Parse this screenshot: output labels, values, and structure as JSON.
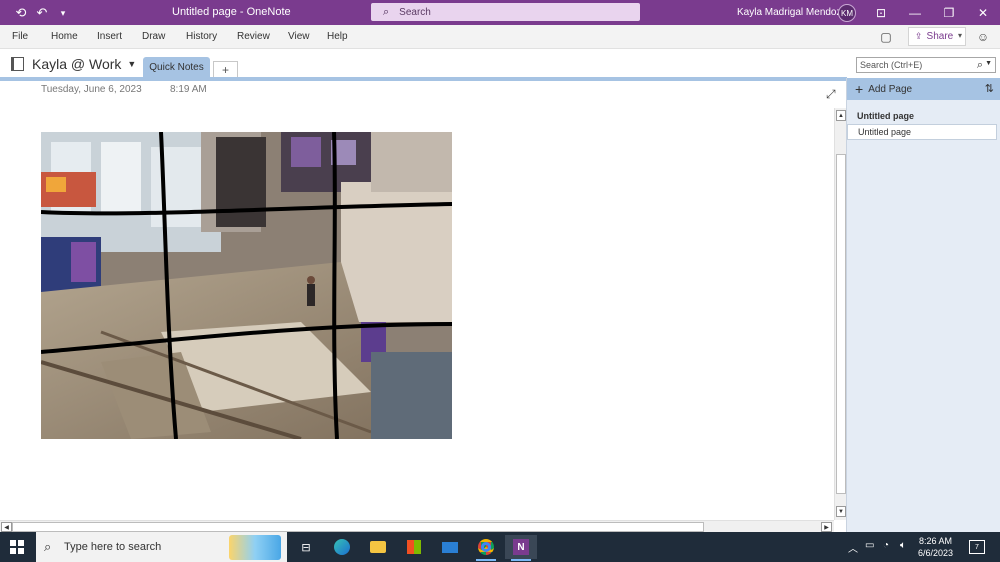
{
  "window": {
    "title": "Untitled page  -  OneNote",
    "search_placeholder": "Search",
    "user_name": "Kayla Madrigal Mendoza",
    "user_initials": "KM"
  },
  "ribbon": {
    "tabs": [
      "File",
      "Home",
      "Insert",
      "Draw",
      "History",
      "Review",
      "View",
      "Help"
    ],
    "share_label": "Share"
  },
  "notebook": {
    "name": "Kayla @ Work",
    "section_tab": "Quick Notes",
    "add_section": "+",
    "search_placeholder": "Search (Ctrl+E)"
  },
  "page": {
    "date": "Tuesday, June 6, 2023",
    "time": "8:19 AM"
  },
  "page_pane": {
    "add_page_label": "Add Page",
    "pages": [
      {
        "title": "Untitled page",
        "active": true
      },
      {
        "title": "Untitled page",
        "active": false
      }
    ]
  },
  "taskbar": {
    "search_placeholder": "Type here to search",
    "apps": [
      "task-view",
      "edge",
      "file-explorer",
      "microsoft-store",
      "mail",
      "chrome",
      "onenote"
    ],
    "time": "8:26 AM",
    "date": "6/6/2023",
    "notification_count": "7"
  },
  "colors": {
    "titlebar": "#7a3b8e",
    "section_tab": "#a6c3e3",
    "page_pane": "#e5ecf5",
    "taskbar": "#1f2c3a"
  }
}
